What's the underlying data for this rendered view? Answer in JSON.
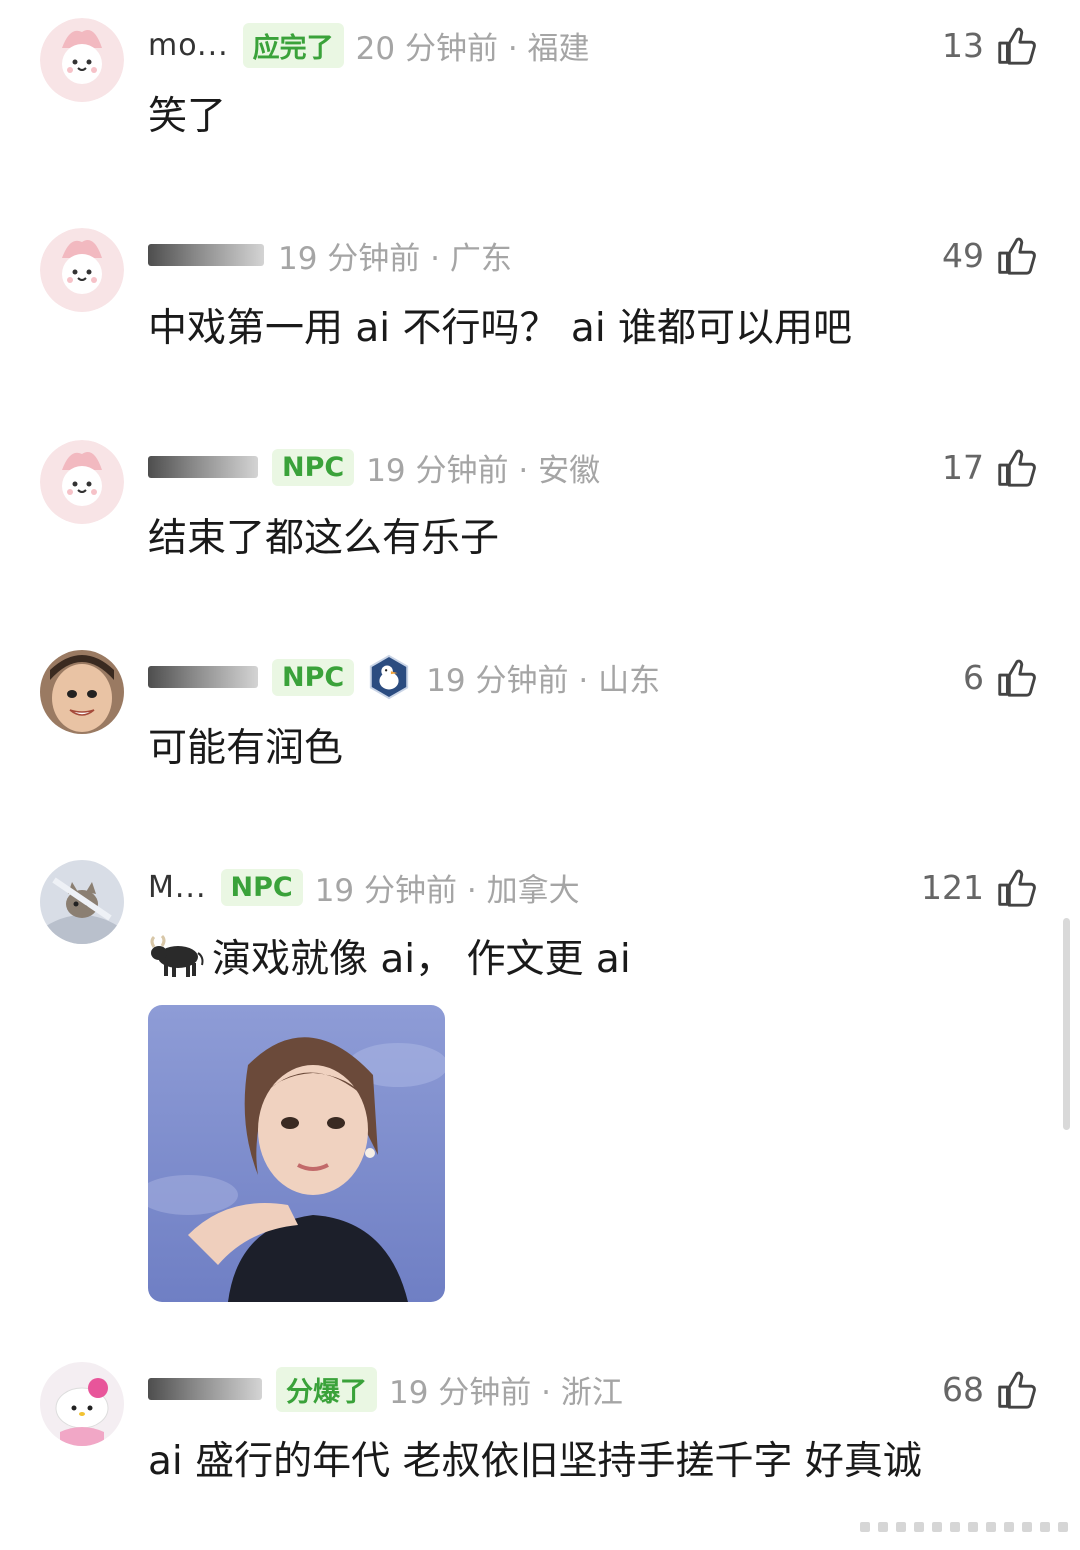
{
  "comments": [
    {
      "username": "mo...",
      "badge": "应完了",
      "time": "20 分钟前 · 福建",
      "likes": "13",
      "text": "笑了"
    },
    {
      "username": "",
      "badge": "",
      "time": "19 分钟前 · 广东",
      "likes": "49",
      "text": "中戏第一用 ai 不行吗？ ai 谁都可以用吧"
    },
    {
      "username": "",
      "badge": "NPC",
      "time": "19 分钟前 · 安徽",
      "likes": "17",
      "text": "结束了都这么有乐子"
    },
    {
      "username": "",
      "badge": "NPC",
      "time": "19 分钟前 · 山东",
      "likes": "6",
      "text": "可能有润色"
    },
    {
      "username": "M...",
      "badge": "NPC",
      "time": "19 分钟前 · 加拿大",
      "likes": "121",
      "text": "演戏就像 ai， 作文更 ai"
    },
    {
      "username": "",
      "badge": "分爆了",
      "time": "19 分钟前 · 浙江",
      "likes": "68",
      "text": "ai 盛行的年代 老叔依旧坚持手搓千字 好真诚"
    }
  ],
  "icons": {
    "like": "thumbs-up-icon",
    "ox": "ox-emoji-icon",
    "medal": "goose-medal-icon"
  },
  "colors": {
    "badge_bg": "#eaf7e3",
    "badge_text": "#3aa23a",
    "meta_text": "#a5a5a5"
  }
}
